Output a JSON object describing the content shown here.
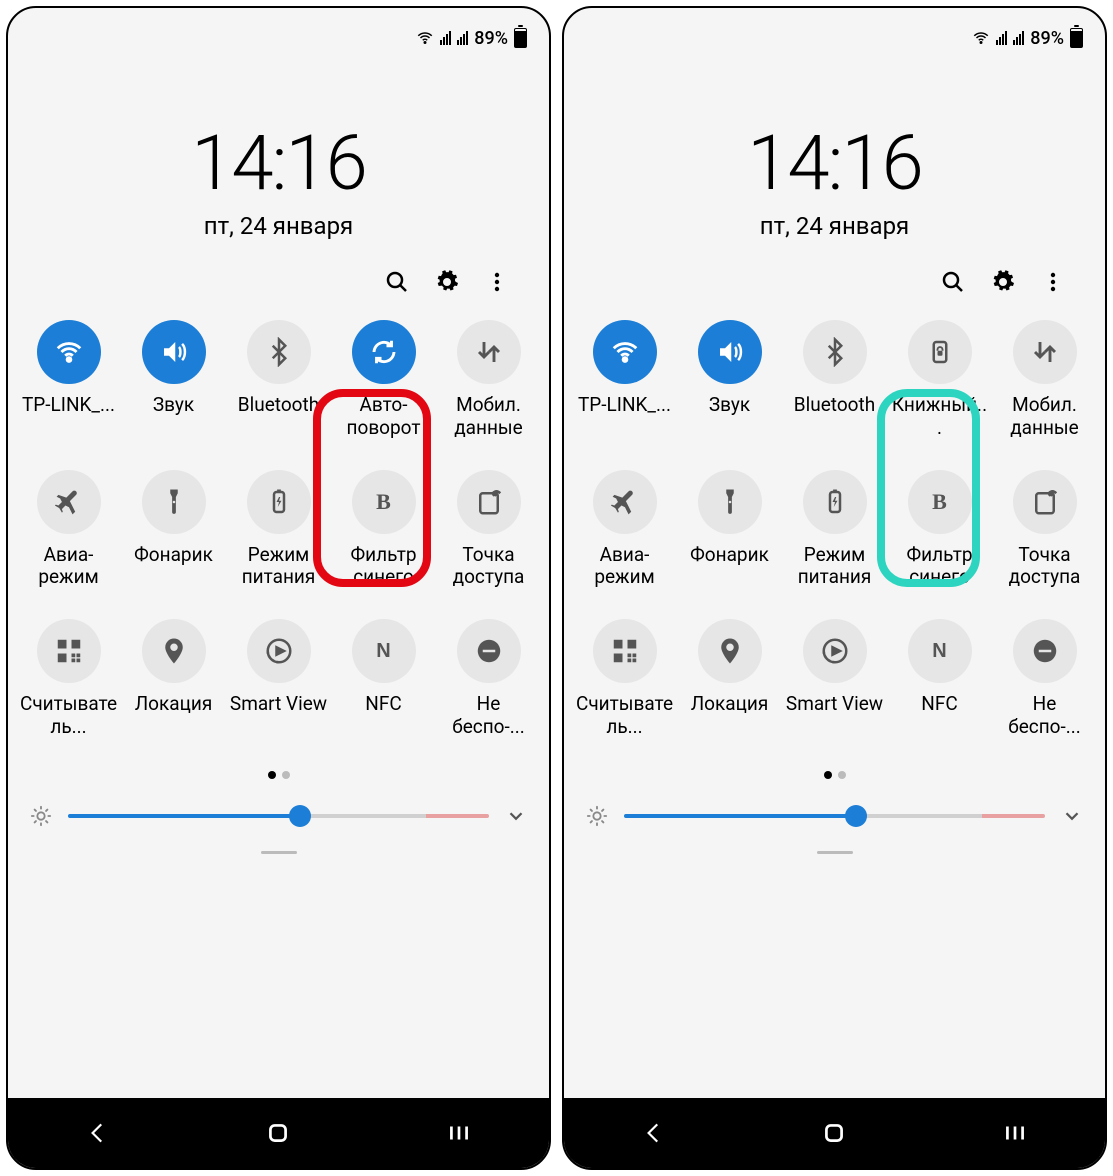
{
  "panels": [
    {
      "status": {
        "battery_pct": "89%"
      },
      "clock": {
        "time": "14:16",
        "date": "пт, 24 января"
      },
      "highlight": {
        "color": "red",
        "tile_index": 3
      },
      "tiles": [
        {
          "icon": "wifi",
          "on": true,
          "label": "TP-LINK_..."
        },
        {
          "icon": "sound",
          "on": true,
          "label": "Звук"
        },
        {
          "icon": "bluetooth",
          "on": false,
          "label": "Bluetooth"
        },
        {
          "icon": "rotate",
          "on": true,
          "label": "Авто-поворот"
        },
        {
          "icon": "mobiledata",
          "on": false,
          "label": "Мобил. данные"
        },
        {
          "icon": "airplane",
          "on": false,
          "label": "Авиа-режим"
        },
        {
          "icon": "flashlight",
          "on": false,
          "label": "Фонарик"
        },
        {
          "icon": "battery-mode",
          "on": false,
          "label": "Режим питания"
        },
        {
          "icon": "blue-filter",
          "on": false,
          "label": "Фильтр синего"
        },
        {
          "icon": "hotspot",
          "on": false,
          "label": "Точка доступа"
        },
        {
          "icon": "qr",
          "on": false,
          "label": "Считыватель..."
        },
        {
          "icon": "location",
          "on": false,
          "label": "Локация"
        },
        {
          "icon": "smartview",
          "on": false,
          "label": "Smart View"
        },
        {
          "icon": "nfc",
          "on": false,
          "label": "NFC"
        },
        {
          "icon": "dnd",
          "on": false,
          "label": "Не беспо-..."
        }
      ],
      "pager": {
        "total": 2,
        "active": 0
      },
      "brightness": {
        "value": 55
      }
    },
    {
      "status": {
        "battery_pct": "89%"
      },
      "clock": {
        "time": "14:16",
        "date": "пт, 24 января"
      },
      "highlight": {
        "color": "teal",
        "tile_index": 3
      },
      "tiles": [
        {
          "icon": "wifi",
          "on": true,
          "label": "TP-LINK_..."
        },
        {
          "icon": "sound",
          "on": true,
          "label": "Звук"
        },
        {
          "icon": "bluetooth",
          "on": false,
          "label": "Bluetooth"
        },
        {
          "icon": "portrait-lock",
          "on": false,
          "label": "Книжный..."
        },
        {
          "icon": "mobiledata",
          "on": false,
          "label": "Мобил. данные"
        },
        {
          "icon": "airplane",
          "on": false,
          "label": "Авиа-режим"
        },
        {
          "icon": "flashlight",
          "on": false,
          "label": "Фонарик"
        },
        {
          "icon": "battery-mode",
          "on": false,
          "label": "Режим питания"
        },
        {
          "icon": "blue-filter",
          "on": false,
          "label": "Фильтр синего"
        },
        {
          "icon": "hotspot",
          "on": false,
          "label": "Точка доступа"
        },
        {
          "icon": "qr",
          "on": false,
          "label": "Считыватель..."
        },
        {
          "icon": "location",
          "on": false,
          "label": "Локация"
        },
        {
          "icon": "smartview",
          "on": false,
          "label": "Smart View"
        },
        {
          "icon": "nfc",
          "on": false,
          "label": "NFC"
        },
        {
          "icon": "dnd",
          "on": false,
          "label": "Не беспо-..."
        }
      ],
      "pager": {
        "total": 2,
        "active": 0
      },
      "brightness": {
        "value": 55
      }
    }
  ]
}
